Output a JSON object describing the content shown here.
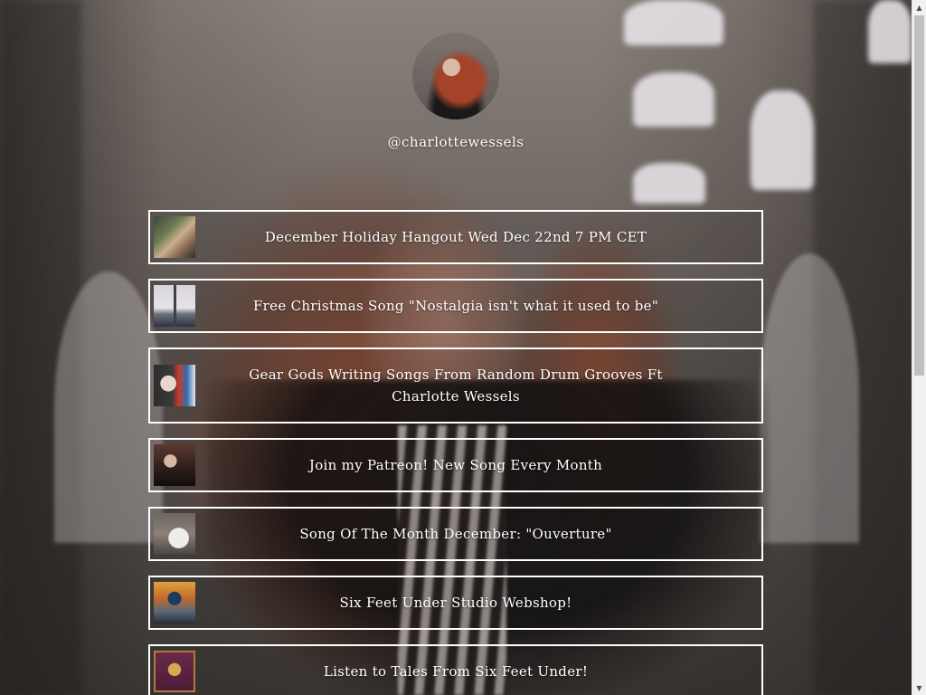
{
  "profile": {
    "username": "@charlottewessels"
  },
  "links": [
    {
      "label": "December Holiday Hangout Wed Dec 22nd 7 PM CET"
    },
    {
      "label": "Free Christmas Song \"Nostalgia isn't what it used to be\""
    },
    {
      "label": "Gear Gods Writing Songs From Random Drum Grooves Ft Charlotte Wessels"
    },
    {
      "label": "Join my Patreon! New Song Every Month"
    },
    {
      "label": "Song Of The Month December: \"Ouverture\""
    },
    {
      "label": "Six Feet Under Studio Webshop!"
    },
    {
      "label": "Listen to Tales From Six Feet Under!"
    }
  ],
  "scrollbar": {
    "up_icon": "triangle-up-icon",
    "down_icon": "triangle-down-icon",
    "up_glyph": "▲",
    "down_glyph": "▼"
  }
}
